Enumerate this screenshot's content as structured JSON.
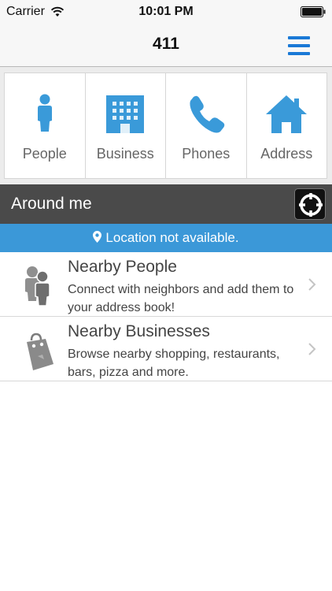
{
  "status_bar": {
    "carrier": "Carrier",
    "time": "10:01 PM"
  },
  "nav": {
    "title": "411",
    "menu_icon": "hamburger-menu-icon",
    "accent_color": "#1a79d6"
  },
  "categories": [
    {
      "label": "People",
      "icon": "person-icon"
    },
    {
      "label": "Business",
      "icon": "building-icon"
    },
    {
      "label": "Phones",
      "icon": "phone-icon"
    },
    {
      "label": "Address",
      "icon": "house-icon"
    }
  ],
  "category_icon_color": "#3a9ad9",
  "around_me": {
    "title": "Around me",
    "locate_icon": "crosshair-icon"
  },
  "location_banner": {
    "text": "Location not available.",
    "icon": "map-pin-icon",
    "color": "#3b98d8"
  },
  "nearby": [
    {
      "title": "Nearby People",
      "description": "Connect with neighbors and add them to your address book!",
      "icon": "people-icon"
    },
    {
      "title": "Nearby Businesses",
      "description": "Browse nearby shopping, restaurants, bars, pizza and more.",
      "icon": "shopping-tag-icon"
    }
  ]
}
